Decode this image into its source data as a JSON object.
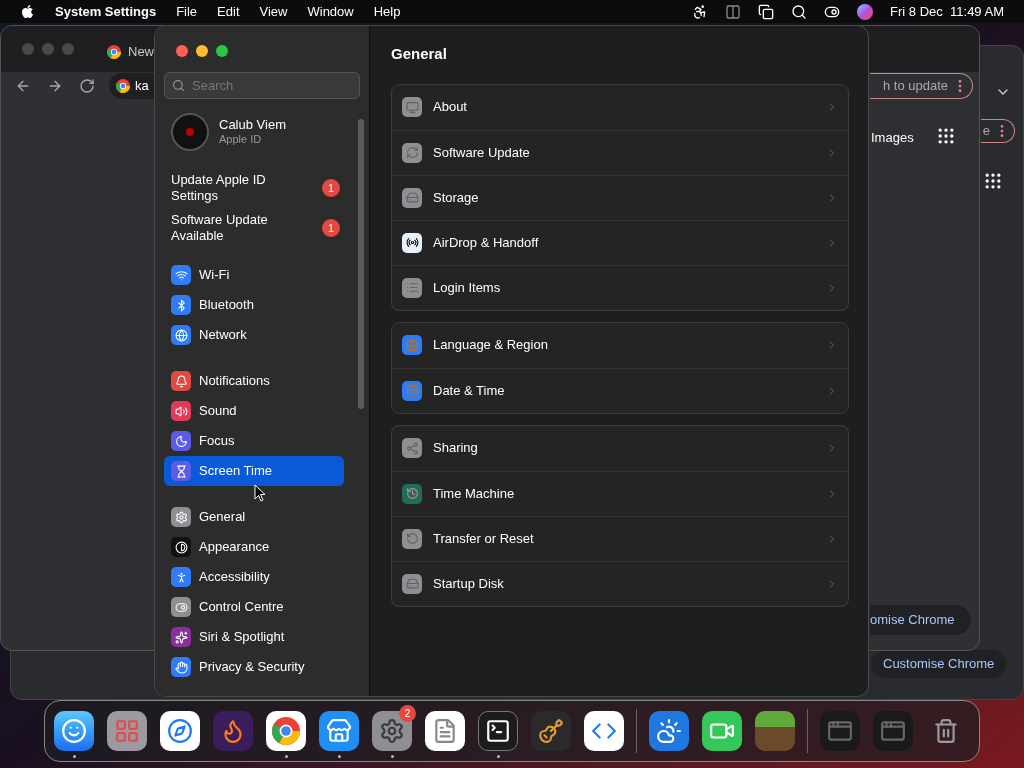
{
  "menu_bar": {
    "app_name": "System Settings",
    "menus": [
      "File",
      "Edit",
      "View",
      "Window",
      "Help"
    ],
    "clock": "Fri 8 Dec  11:49 AM"
  },
  "back_browser": {
    "menu_pill": "e",
    "customise": "Customise Chrome"
  },
  "browser": {
    "tab": "New",
    "address": "ka",
    "update_pill": "h to update",
    "images_link": "Images",
    "customise": "omise Chrome"
  },
  "settings": {
    "search": {
      "placeholder": "Search"
    },
    "account": {
      "name": "Calub Viem",
      "subtitle": "Apple ID"
    },
    "alerts": [
      {
        "label": "Update Apple ID Settings",
        "count": "1"
      },
      {
        "label": "Software Update Available",
        "count": "1"
      }
    ],
    "sidebar": [
      [
        {
          "label": "Wi-Fi",
          "selected": false,
          "color": "#2f7cf6"
        },
        {
          "label": "Bluetooth",
          "selected": false,
          "color": "#2f7cf6"
        },
        {
          "label": "Network",
          "selected": false,
          "color": "#2f7cf6"
        }
      ],
      [
        {
          "label": "Notifications",
          "selected": false,
          "color": "#e5483f"
        },
        {
          "label": "Sound",
          "selected": false,
          "color": "#e3395a"
        },
        {
          "label": "Focus",
          "selected": false,
          "color": "#5e5ce6"
        },
        {
          "label": "Screen Time",
          "selected": true,
          "color": "#5e5ce6"
        }
      ],
      [
        {
          "label": "General",
          "selected": false,
          "color": "#8e8e93"
        },
        {
          "label": "Appearance",
          "selected": false,
          "color": "#111111"
        },
        {
          "label": "Accessibility",
          "selected": false,
          "color": "#2f7cf6"
        },
        {
          "label": "Control Centre",
          "selected": false,
          "color": "#8e8e93"
        },
        {
          "label": "Siri & Spotlight",
          "selected": false,
          "color": "#8a2f9e"
        },
        {
          "label": "Privacy & Security",
          "selected": false,
          "color": "#2f7cf6"
        }
      ]
    ],
    "title": "General",
    "groups": [
      [
        {
          "label": "About",
          "color": "#8e8e93"
        },
        {
          "label": "Software Update",
          "color": "#8e8e93"
        },
        {
          "label": "Storage",
          "color": "#8e8e93"
        },
        {
          "label": "AirDrop & Handoff",
          "color": "#e8f0fb"
        },
        {
          "label": "Login Items",
          "color": "#8e8e93"
        }
      ],
      [
        {
          "label": "Language & Region",
          "color": "#2f7cf6"
        },
        {
          "label": "Date & Time",
          "color": "#2f7cf6"
        }
      ],
      [
        {
          "label": "Sharing",
          "color": "#8e8e93"
        },
        {
          "label": "Time Machine",
          "color": "#1f6e5a"
        },
        {
          "label": "Transfer or Reset",
          "color": "#8e8e93"
        },
        {
          "label": "Startup Disk",
          "color": "#8e8e93"
        }
      ]
    ]
  },
  "dock": [
    [
      {
        "running": true
      },
      {
        "running": false
      },
      {
        "running": false
      },
      {
        "running": false
      },
      {
        "running": true
      },
      {
        "running": true
      },
      {
        "running": true,
        "badge": "2"
      },
      {
        "running": false
      },
      {
        "running": true
      },
      {
        "running": false
      },
      {
        "running": false
      }
    ],
    [
      {
        "running": false
      },
      {
        "running": false
      },
      {
        "running": false
      }
    ],
    [
      {
        "running": false
      },
      {
        "running": false
      },
      {
        "running": false
      }
    ]
  ]
}
